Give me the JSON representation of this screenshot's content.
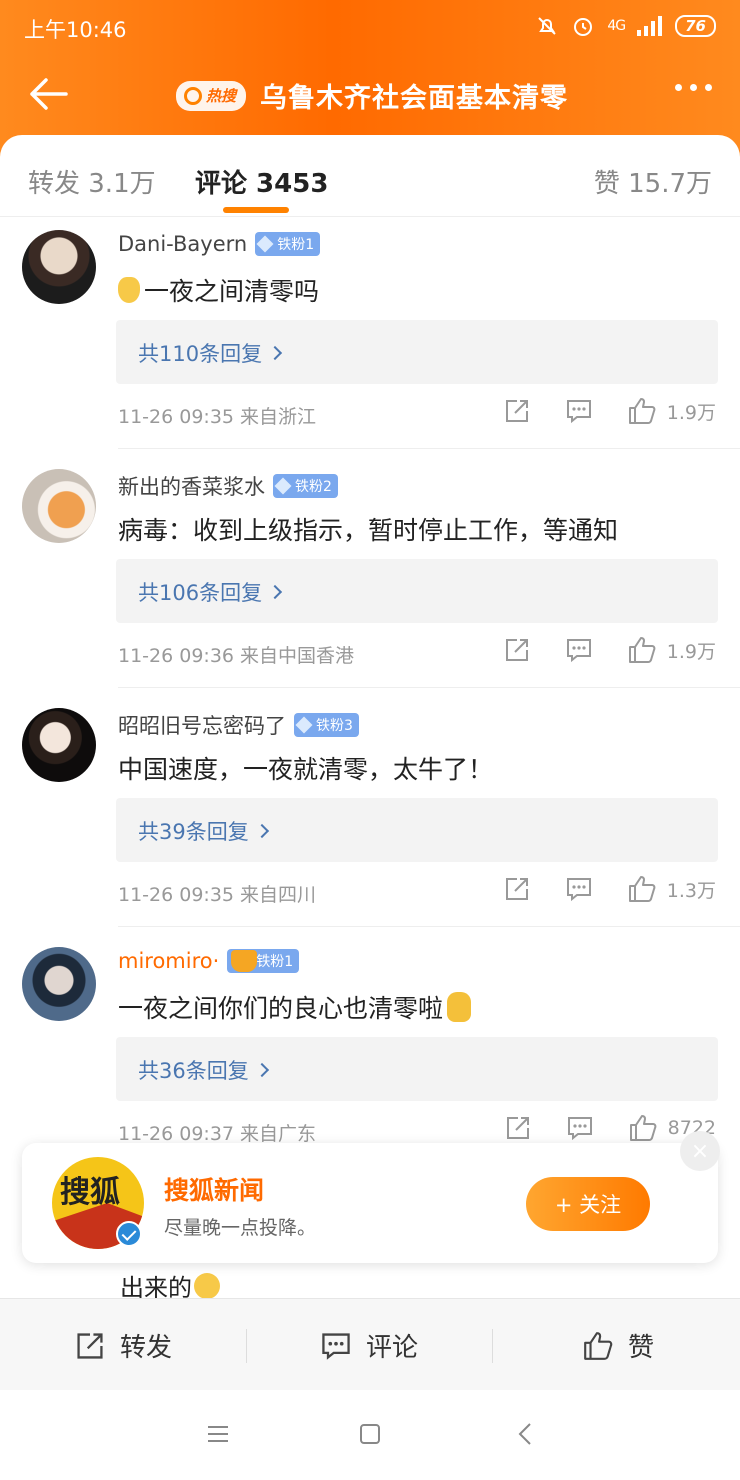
{
  "status_bar": {
    "time": "上午10:46",
    "network": "4G",
    "battery": "76"
  },
  "header": {
    "hot_badge": "热搜",
    "title": "乌鲁木齐社会面基本清零"
  },
  "tabs": {
    "repost": "转发 3.1万",
    "comment": "评论 3453",
    "like": "赞 15.7万"
  },
  "comments": [
    {
      "user": "Dani-Bayern",
      "fan_badge": "铁粉1",
      "text": "一夜之间清零吗",
      "replies": "共110条回复",
      "meta": "11-26 09:35 来自浙江",
      "likes": "1.9万"
    },
    {
      "user": "新出的香菜浆水",
      "fan_badge": "铁粉2",
      "text": "病毒：收到上级指示，暂时停止工作，等通知",
      "replies": "共106条回复",
      "meta": "11-26 09:36 来自中国香港",
      "likes": "1.9万"
    },
    {
      "user": "昭昭旧号忘密码了",
      "fan_badge": "铁粉3",
      "text": "中国速度，一夜就清零，太牛了！",
      "replies": "共39条回复",
      "meta": "11-26 09:35 来自四川",
      "likes": "1.3万"
    },
    {
      "user": "miromiro·",
      "fan_badge": "铁粉1",
      "text": "一夜之间你们的良心也清零啦",
      "replies": "共36条回复",
      "meta": "11-26 09:37 来自广东",
      "likes": "8722"
    }
  ],
  "follow_popup": {
    "logo_text": "搜狐",
    "name": "搜狐新闻",
    "desc": "尽量晚一点投降。",
    "button": "+ 关注",
    "close": "×"
  },
  "partial_comment": "出来的",
  "bottom_bar": {
    "repost": "转发",
    "comment": "评论",
    "like": "赞"
  },
  "colors": {
    "brand_orange": "#ff8200",
    "link_blue": "#4a76b0"
  }
}
